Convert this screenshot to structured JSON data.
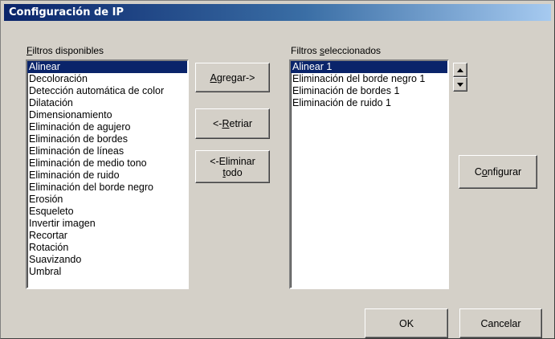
{
  "window": {
    "title": "Configuración de IP"
  },
  "available": {
    "label_pre": "",
    "label_u": "F",
    "label_post": "iltros disponibles",
    "items": [
      "Alinear",
      "Decoloración",
      "Detección automática de color",
      "Dilatación",
      "Dimensionamiento",
      "Eliminación de agujero",
      "Eliminación de bordes",
      "Eliminación de líneas",
      "Eliminación de medio tono",
      "Eliminación de ruido",
      "Eliminación del borde negro",
      "Erosión",
      "Esqueleto",
      "Invertir imagen",
      "Recortar",
      "Rotación",
      "Suavizando",
      "Umbral"
    ],
    "selected_index": 0
  },
  "selected": {
    "label_pre": "Filtros ",
    "label_u": "s",
    "label_post": "eleccionados",
    "items": [
      "Alinear 1",
      "Eliminación del borde negro 1",
      "Eliminación de bordes 1",
      "Eliminación de ruido 1"
    ],
    "selected_index": 0
  },
  "buttons": {
    "add": {
      "pre": "",
      "u": "A",
      "post": "gregar->"
    },
    "remove": {
      "pre": "<-",
      "u": "R",
      "post": "etriar"
    },
    "remove_all": {
      "line1": "<-Eliminar",
      "u": "t",
      "post": "odo"
    },
    "configure": {
      "pre": "C",
      "u": "o",
      "post": "nfigurar"
    },
    "ok": "OK",
    "cancel": "Cancelar"
  },
  "icons": {
    "up": "scroll-up-arrow",
    "down": "scroll-down-arrow"
  },
  "colors": {
    "selection": "#0a246a",
    "face": "#d4d0c8",
    "title_start": "#0a246a",
    "title_end": "#a6caf0"
  }
}
